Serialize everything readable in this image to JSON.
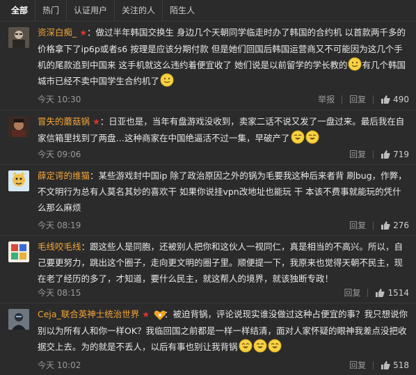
{
  "tabs": [
    {
      "label": "全部",
      "active": true
    },
    {
      "label": "热门"
    },
    {
      "label": "认证用户"
    },
    {
      "label": "关注的人"
    },
    {
      "label": "陌生人"
    }
  ],
  "comments": [
    {
      "username": "资深白痴_",
      "badge": "★",
      "text": "：做过半年韩国交换生 身边几个天朝同学临走时办了韩国的合约机 以首款两千多的价格拿下了ip6p或者s6 按理是应该分期付款 但是她们回国后韩国运营商又不可能因为这几个手机的尾款追到中国来 这手机就这么违约着便宜收了 她们说是以前留学的学长教的",
      "text_after": "有几个韩国城市已经不卖中国学生合约机了",
      "time": "今天 10:30",
      "report": "举报",
      "reply": "回复",
      "likes": "490"
    },
    {
      "username": "冒失的蘑菇锅",
      "badge": "★",
      "text": "：日亚也是，当年有盘游戏没收到，卖家二话不说又发了一盘过来。最后我在自家信箱里找到了两盘…这种商家在中国绝逼活不过一集，早破产了",
      "time": "今天 09:06",
      "reply": "回复",
      "likes": "719"
    },
    {
      "username": "薛定谔的维猫",
      "text": "：某些游戏封中国ip 除了政治原因之外的锅为毛要我这种后来者背 刷bug，作弊，不文明行为总有人莫名其妙的喜欢干 如果你说挂vpn改地址也能玩 干 本该不费事就能玩的凭什么那么麻烦",
      "time": "今天 08:19",
      "reply": "回复",
      "likes": "276"
    },
    {
      "username": "毛线咬毛线",
      "text": "：跟这些人是同胞，还被别人把你和这伙人一视同仁，真是相当的不高兴。所以，自己要更努力，跳出这个圈子，走向更文明的圈子里。顺便提一下，我原来也觉得天朝不民主，现在老了经历的多了，才知道，要什么民主，就这帮人的境界，就该独断专政！",
      "time": "今天 08:15",
      "reply": "回复",
      "likes": "1514"
    },
    {
      "username": "Ceja_联合英神士统治世界",
      "badge": "★",
      "text": "：被迫背锅，评论说现实谁没做过这种占便宜的事？我只想说你别以为所有人和你一样OK？我临回国之前都是一样一样结清，面对人家怀疑的眼神我差点没把收据交上去。为的就是不丢人，以后有事也别让我背锅",
      "time": "今天 10:02",
      "reply": "回复",
      "likes": "518"
    }
  ]
}
